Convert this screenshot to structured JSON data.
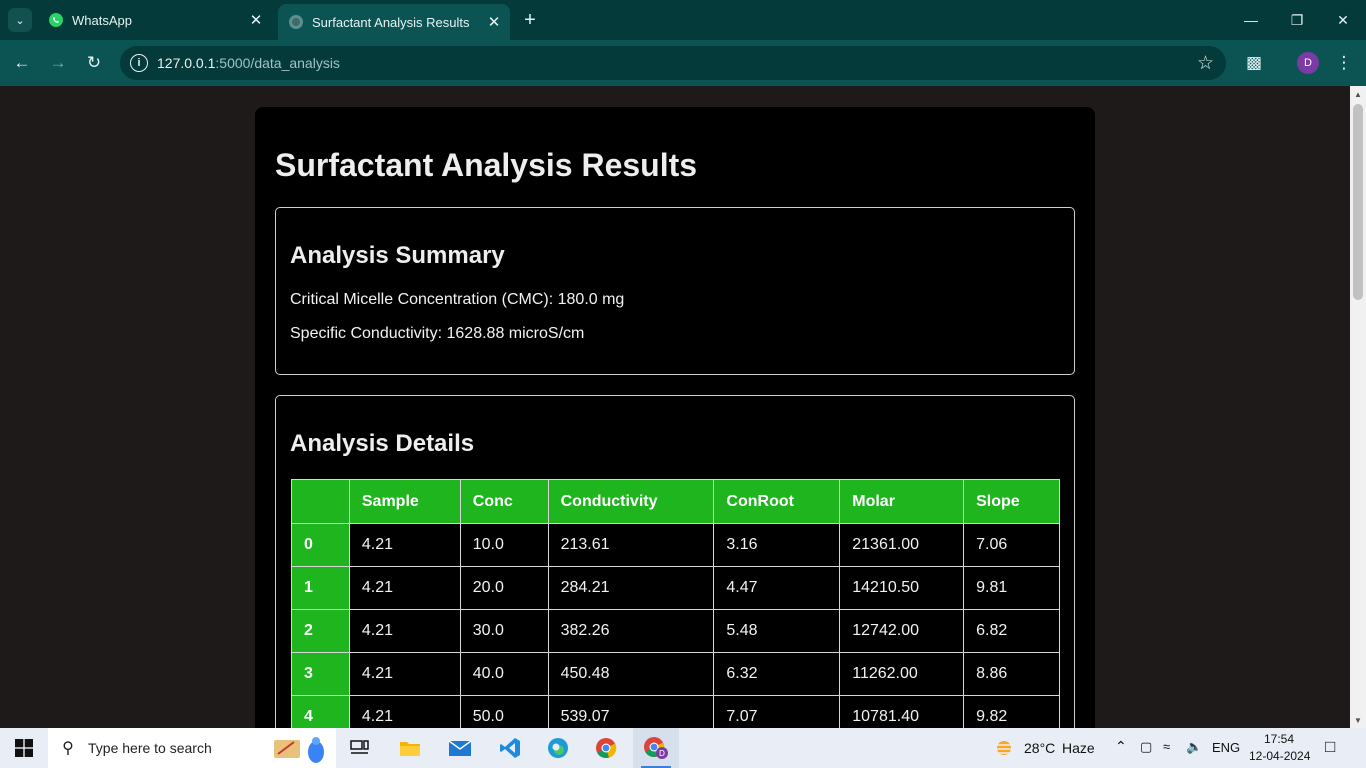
{
  "browser": {
    "tabs": [
      {
        "label": "WhatsApp",
        "active": false,
        "icon": "whatsapp-icon"
      },
      {
        "label": "Surfactant Analysis Results",
        "active": true,
        "icon": "globe-icon"
      }
    ],
    "url_host": "127.0.0.1",
    "url_path": ":5000/data_analysis",
    "profile_initial": "D"
  },
  "page": {
    "title": "Surfactant Analysis Results",
    "summary": {
      "heading": "Analysis Summary",
      "cmc": "Critical Micelle Concentration (CMC): 180.0 mg",
      "conductivity": "Specific Conductivity: 1628.88 microS/cm"
    },
    "details": {
      "heading": "Analysis Details",
      "columns": [
        "",
        "Sample",
        "Conc",
        "Conductivity",
        "ConRoot",
        "Molar",
        "Slope"
      ],
      "rows": [
        [
          "0",
          "4.21",
          "10.0",
          "213.61",
          "3.16",
          "21361.00",
          "7.06"
        ],
        [
          "1",
          "4.21",
          "20.0",
          "284.21",
          "4.47",
          "14210.50",
          "9.81"
        ],
        [
          "2",
          "4.21",
          "30.0",
          "382.26",
          "5.48",
          "12742.00",
          "6.82"
        ],
        [
          "3",
          "4.21",
          "40.0",
          "450.48",
          "6.32",
          "11262.00",
          "8.86"
        ],
        [
          "4",
          "4.21",
          "50.0",
          "539.07",
          "7.07",
          "10781.40",
          "9.82"
        ]
      ]
    }
  },
  "taskbar": {
    "search_placeholder": "Type here to search",
    "weather_temp": "28°C",
    "weather_desc": "Haze",
    "language": "ENG",
    "time": "17:54",
    "date": "12-04-2024"
  },
  "colors": {
    "table_header": "#1eb51e",
    "card_bg": "#000000",
    "page_bg": "#1e1a1a",
    "chrome_dark": "#053a3a",
    "chrome_toolbar": "#0c5454"
  }
}
